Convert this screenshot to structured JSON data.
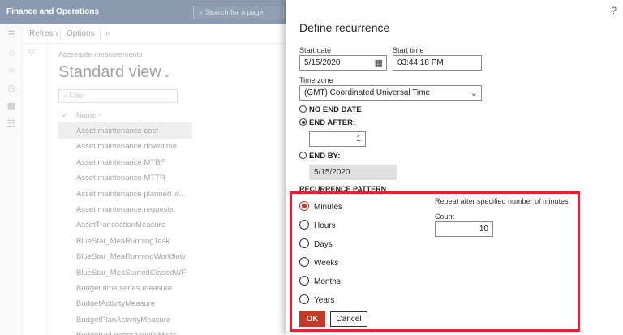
{
  "app": {
    "title": "Finance and Operations",
    "search_placeholder": "Search for a page"
  },
  "actionbar": {
    "refresh": "Refresh",
    "options": "Options"
  },
  "workspace": {
    "breadcrumb": "Aggregate measurements",
    "view_title": "Standard view",
    "filter_placeholder": "Filter",
    "column_name": "Name ↑",
    "rows": [
      "Asset maintenance cost",
      "Asset maintenance downtime",
      "Asset maintenance MTBF",
      "Asset maintenance MTTR",
      "Asset maintenance planned w...",
      "Asset maintenance requests",
      "AssetTransactionMeasure",
      "BlueStar_MeaRunningTask",
      "BlueStar_MeaRunningWorkflow",
      "BlueStar_MeaStartedClosedWF",
      "Budget time series measure",
      "BudgetActivityMeasure",
      "BudgetPlanActivityMeasure",
      "BudgetVsLedgerActivityMeas..."
    ],
    "selected_index": 0
  },
  "dialog": {
    "help": "?",
    "title": "Define recurrence",
    "start_date_label": "Start date",
    "start_date": "5/15/2020",
    "start_time_label": "Start time",
    "start_time": "03:44:18 PM",
    "timezone_label": "Time zone",
    "timezone": "(GMT) Coordinated Universal Time",
    "end_options": {
      "no_end": "NO END DATE",
      "end_after": "END AFTER:",
      "end_after_value": "1",
      "end_by": "END BY:",
      "end_by_value": "5/15/2020",
      "selected": "end_after"
    },
    "pattern_heading": "RECURRENCE PATTERN",
    "pattern_options": [
      "Minutes",
      "Hours",
      "Days",
      "Weeks",
      "Months",
      "Years"
    ],
    "pattern_selected": "Minutes",
    "repeat_text": "Repeat after specified number of minutes",
    "count_label": "Count",
    "count_value": "10",
    "ok_label": "OK",
    "cancel_label": "Cancel",
    "highlight_color": "#e8212b"
  }
}
